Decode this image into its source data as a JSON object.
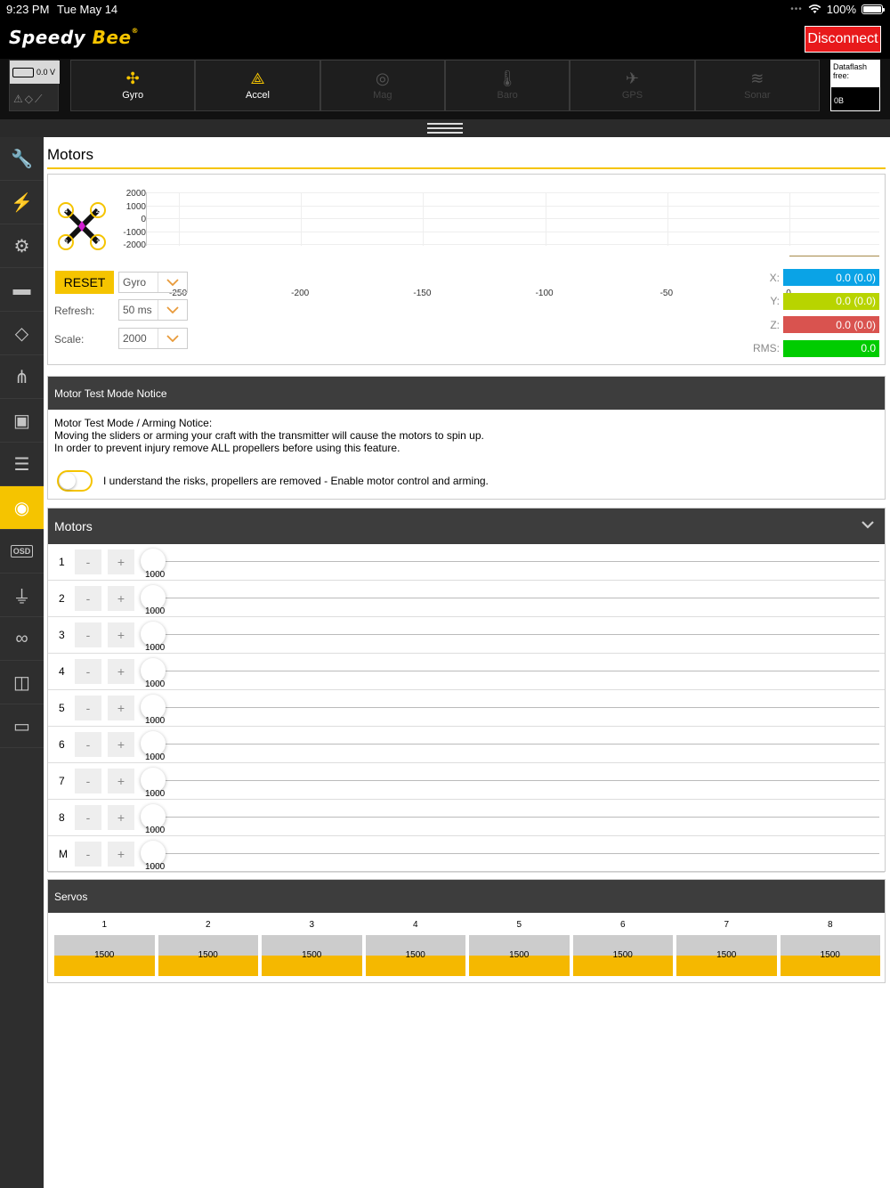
{
  "status": {
    "time": "9:23 PM",
    "date": "Tue May 14",
    "battery": "100%"
  },
  "header": {
    "logo_main": "Speedy",
    "logo_accent": "Bee",
    "disconnect": "Disconnect"
  },
  "battery_box": {
    "voltage": "0.0 V"
  },
  "sensors": [
    {
      "label": "Gyro",
      "icon": "gyro-icon",
      "active": true
    },
    {
      "label": "Accel",
      "icon": "accel-icon",
      "active": true
    },
    {
      "label": "Mag",
      "icon": "compass-icon",
      "active": false
    },
    {
      "label": "Baro",
      "icon": "thermometer-icon",
      "active": false
    },
    {
      "label": "GPS",
      "icon": "satellite-icon",
      "active": false
    },
    {
      "label": "Sonar",
      "icon": "sonar-icon",
      "active": false
    }
  ],
  "dataflash": {
    "label": "Dataflash free:",
    "value": "0B"
  },
  "sidebar": [
    "wrench-icon",
    "plug-icon",
    "gear-icon",
    "battery-icon",
    "parachute-icon",
    "network-icon",
    "remote-icon",
    "sliders-icon",
    "motor-icon",
    "osd-icon",
    "led-icon",
    "blackbox-icon",
    "video-icon",
    "cli-icon"
  ],
  "sidebar_active_index": 8,
  "sidebar_osd_text": "OSD",
  "page": {
    "title": "Motors"
  },
  "graph": {
    "yticks": [
      "2000",
      "1000",
      "0",
      "-1000",
      "-2000"
    ],
    "xticks": [
      "-250",
      "-200",
      "-150",
      "-100",
      "-50",
      "0"
    ],
    "motor_labels": [
      "4",
      "2",
      "3",
      "1"
    ]
  },
  "controls": {
    "reset": "RESET",
    "source": "Gyro",
    "refresh_label": "Refresh:",
    "refresh": "50 ms",
    "scale_label": "Scale:",
    "scale": "2000"
  },
  "axes": [
    {
      "label": "X:",
      "value": "0.0 (0.0)",
      "color": "#0aa3e6"
    },
    {
      "label": "Y:",
      "value": "0.0 (0.0)",
      "color": "#b8d400"
    },
    {
      "label": "Z:",
      "value": "0.0 (0.0)",
      "color": "#d9534f"
    },
    {
      "label": "RMS:",
      "value": "0.0",
      "color": "#00cc00"
    }
  ],
  "notice": {
    "title": "Motor Test Mode Notice",
    "line1": "Motor Test Mode / Arming Notice:",
    "line2": "Moving the sliders or arming your craft with the transmitter will cause the motors to spin up.",
    "line3": "In order to prevent injury remove ALL propellers before using this feature.",
    "toggle_label": "I understand the risks, propellers are removed - Enable motor control and arming."
  },
  "motors": {
    "title": "Motors",
    "minus": "-",
    "plus": "+",
    "rows": [
      {
        "name": "1",
        "value": "1000"
      },
      {
        "name": "2",
        "value": "1000"
      },
      {
        "name": "3",
        "value": "1000"
      },
      {
        "name": "4",
        "value": "1000"
      },
      {
        "name": "5",
        "value": "1000"
      },
      {
        "name": "6",
        "value": "1000"
      },
      {
        "name": "7",
        "value": "1000"
      },
      {
        "name": "8",
        "value": "1000"
      },
      {
        "name": "M",
        "value": "1000"
      }
    ]
  },
  "servos": {
    "title": "Servos",
    "items": [
      {
        "name": "1",
        "value": "1500"
      },
      {
        "name": "2",
        "value": "1500"
      },
      {
        "name": "3",
        "value": "1500"
      },
      {
        "name": "4",
        "value": "1500"
      },
      {
        "name": "5",
        "value": "1500"
      },
      {
        "name": "6",
        "value": "1500"
      },
      {
        "name": "7",
        "value": "1500"
      },
      {
        "name": "8",
        "value": "1500"
      }
    ]
  }
}
